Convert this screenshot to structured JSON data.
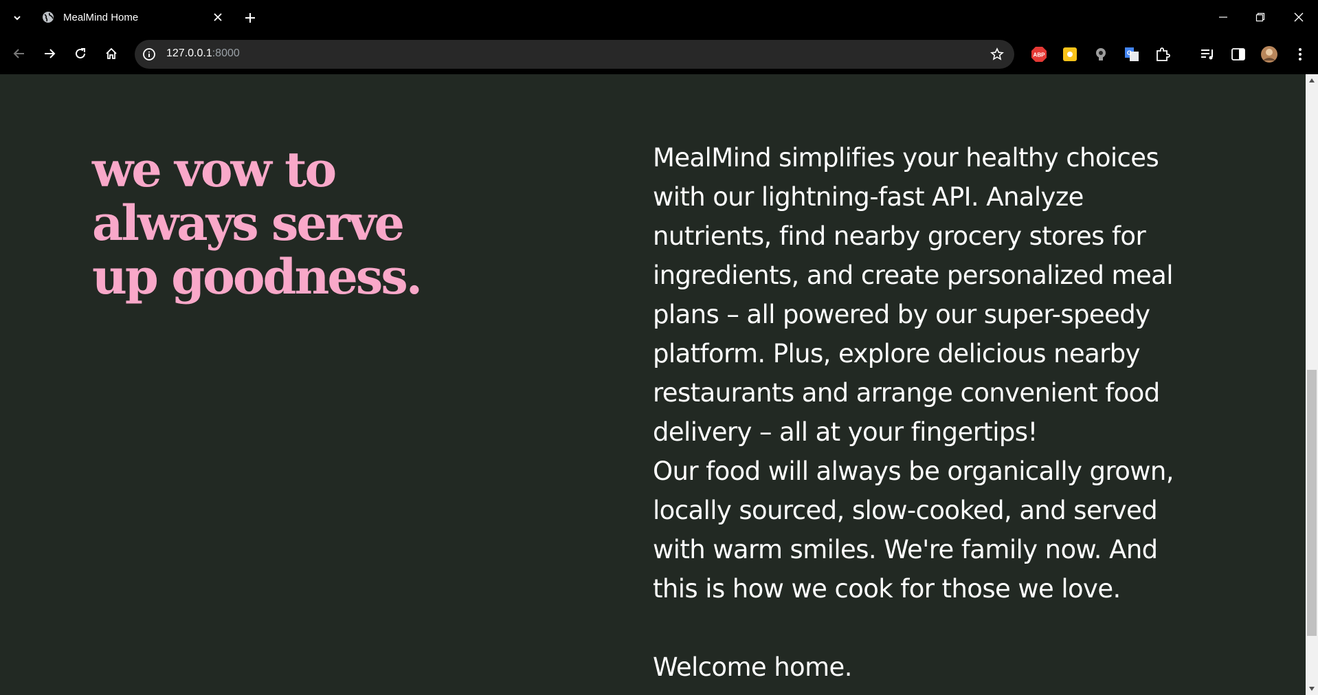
{
  "browser": {
    "tab": {
      "title": "MealMind Home"
    },
    "address": {
      "host": "127.0.0.1",
      "port": ":8000"
    },
    "icons": {
      "tab_search": "chevron-down-icon",
      "favicon": "globe-icon",
      "close": "close-icon",
      "new_tab": "plus-icon",
      "back": "back-arrow-icon",
      "forward": "forward-arrow-icon",
      "reload": "reload-icon",
      "home": "home-icon",
      "site_info": "info-icon",
      "bookmark": "star-icon",
      "extensions": [
        "adblock-icon",
        "yellow-extension-icon",
        "bulb-extension-icon",
        "translate-icon",
        "puzzle-icon"
      ],
      "media": "media-control-icon",
      "side_panel": "side-panel-icon",
      "profile": "avatar",
      "menu": "kebab-menu-icon"
    },
    "adblock_label": "ABP"
  },
  "page": {
    "colors": {
      "background": "#222923",
      "headline": "#f9a8c9",
      "text": "#ffffff"
    },
    "headline_lines": [
      "we vow to",
      "always serve",
      "up goodness."
    ],
    "body_lines": [
      "MealMind simplifies your healthy choices",
      "with our lightning-fast API. Analyze",
      "nutrients, find nearby grocery stores for",
      "ingredients, and create personalized meal",
      "plans – all powered by our super-speedy",
      "platform. Plus, explore delicious nearby",
      "restaurants and arrange convenient food",
      "delivery – all at your fingertips!",
      "Our food will always be organically grown,",
      "locally sourced, slow-cooked, and served",
      "with warm smiles. We're family now. And",
      "this is how we cook for those we love."
    ],
    "welcome": "Welcome home."
  }
}
